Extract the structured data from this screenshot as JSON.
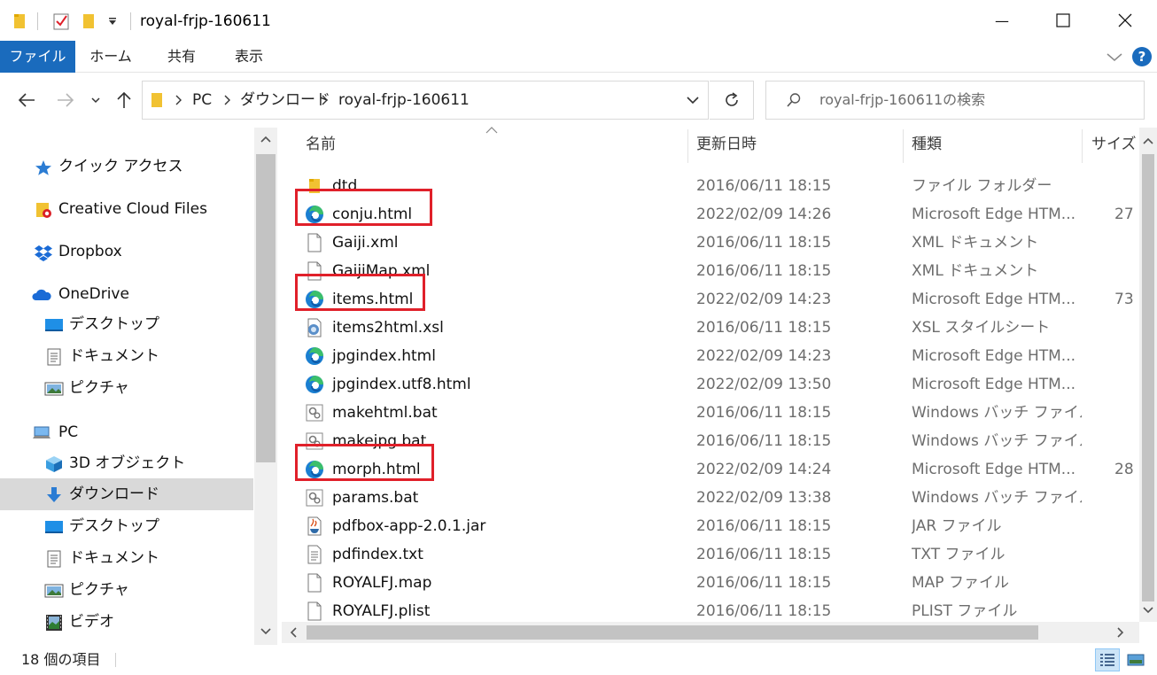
{
  "window": {
    "title": "royal-frjp-160611",
    "minimize_glyph": "—",
    "maximize_glyph": "☐",
    "close_glyph": "✕"
  },
  "ribbon": {
    "tabs": [
      "ファイル",
      "ホーム",
      "共有",
      "表示"
    ],
    "help_glyph": "?"
  },
  "address": {
    "crumbs": [
      "PC",
      "ダウンロード",
      "royal-frjp-160611"
    ]
  },
  "search": {
    "placeholder": "royal-frjp-160611の検索"
  },
  "nav": {
    "items": [
      {
        "label": "クイック アクセス",
        "icon": "star-icon"
      },
      {
        "label": "Creative Cloud Files",
        "icon": "creative-cloud-folder-icon"
      },
      {
        "label": "Dropbox",
        "icon": "dropbox-icon"
      },
      {
        "label": "OneDrive",
        "icon": "onedrive-cloud-icon"
      },
      {
        "label": "デスクトップ",
        "icon": "desktop-icon"
      },
      {
        "label": "ドキュメント",
        "icon": "document-icon"
      },
      {
        "label": "ピクチャ",
        "icon": "picture-icon"
      },
      {
        "label": "PC",
        "icon": "pc-icon"
      },
      {
        "label": "3D オブジェクト",
        "icon": "3d-objects-icon"
      },
      {
        "label": "ダウンロード",
        "icon": "download-arrow-icon"
      },
      {
        "label": "デスクトップ",
        "icon": "desktop-icon"
      },
      {
        "label": "ドキュメント",
        "icon": "document-icon"
      },
      {
        "label": "ピクチャ",
        "icon": "picture-icon"
      },
      {
        "label": "ビデオ",
        "icon": "video-icon"
      }
    ]
  },
  "files": {
    "columns": {
      "name": "名前",
      "date": "更新日時",
      "type": "種類",
      "size": "サイズ"
    },
    "rows": [
      {
        "name": "dtd",
        "date": "2016/06/11 18:15",
        "type": "ファイル フォルダー",
        "size": "",
        "icon": "folder-icon",
        "highlighted": false
      },
      {
        "name": "conju.html",
        "date": "2022/02/09 14:26",
        "type": "Microsoft Edge HTM...",
        "size": "27",
        "icon": "edge-icon",
        "highlighted": true
      },
      {
        "name": "Gaiji.xml",
        "date": "2016/06/11 18:15",
        "type": "XML ドキュメント",
        "size": "",
        "icon": "xml-file-icon",
        "highlighted": false
      },
      {
        "name": "GaijiMap.xml",
        "date": "2016/06/11 18:15",
        "type": "XML ドキュメント",
        "size": "",
        "icon": "xml-file-icon",
        "highlighted": false
      },
      {
        "name": "items.html",
        "date": "2022/02/09 14:23",
        "type": "Microsoft Edge HTM...",
        "size": "73",
        "icon": "edge-icon",
        "highlighted": true
      },
      {
        "name": "items2html.xsl",
        "date": "2016/06/11 18:15",
        "type": "XSL スタイルシート",
        "size": "",
        "icon": "xsl-file-icon",
        "highlighted": false
      },
      {
        "name": "jpgindex.html",
        "date": "2022/02/09 14:23",
        "type": "Microsoft Edge HTM...",
        "size": "",
        "icon": "edge-icon",
        "highlighted": false
      },
      {
        "name": "jpgindex.utf8.html",
        "date": "2022/02/09 13:50",
        "type": "Microsoft Edge HTM...",
        "size": "",
        "icon": "edge-icon",
        "highlighted": false
      },
      {
        "name": "makehtml.bat",
        "date": "2016/06/11 18:15",
        "type": "Windows バッチ ファイル",
        "size": "",
        "icon": "batch-file-icon",
        "highlighted": false
      },
      {
        "name": "makejpg.bat",
        "date": "2016/06/11 18:15",
        "type": "Windows バッチ ファイル",
        "size": "",
        "icon": "batch-file-icon",
        "highlighted": false
      },
      {
        "name": "morph.html",
        "date": "2022/02/09 14:24",
        "type": "Microsoft Edge HTM...",
        "size": "28",
        "icon": "edge-icon",
        "highlighted": true
      },
      {
        "name": "params.bat",
        "date": "2022/02/09 13:38",
        "type": "Windows バッチ ファイル",
        "size": "",
        "icon": "batch-file-icon",
        "highlighted": false
      },
      {
        "name": "pdfbox-app-2.0.1.jar",
        "date": "2016/06/11 18:15",
        "type": "JAR ファイル",
        "size": "",
        "icon": "jar-file-icon",
        "highlighted": false
      },
      {
        "name": "pdfindex.txt",
        "date": "2016/06/11 18:15",
        "type": "TXT ファイル",
        "size": "",
        "icon": "text-file-icon",
        "highlighted": false
      },
      {
        "name": "ROYALFJ.map",
        "date": "2016/06/11 18:15",
        "type": "MAP ファイル",
        "size": "",
        "icon": "blank-file-icon",
        "highlighted": false
      },
      {
        "name": "ROYALFJ.plist",
        "date": "2016/06/11 18:15",
        "type": "PLIST ファイル",
        "size": "",
        "icon": "blank-file-icon",
        "highlighted": false
      }
    ]
  },
  "status": {
    "item_count": "18 個の項目"
  },
  "colors": {
    "accent": "#1a6bbd",
    "highlight_border": "#e0202a",
    "selected_nav": "#d9d9d9",
    "folder": "#f1c232",
    "edge_blue": "#1b7fd1",
    "edge_green": "#3bbf6b"
  }
}
